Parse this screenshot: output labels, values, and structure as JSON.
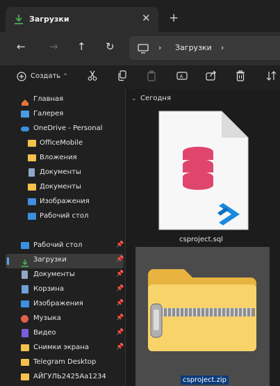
{
  "window": {
    "tab_title": "Загрузки",
    "tab_close": "✕",
    "new_tab": "+"
  },
  "nav": {
    "back": "←",
    "forward": "→",
    "up": "↑",
    "refresh": "↻",
    "sep1": "›",
    "sep2": "›",
    "crumb": "Загрузки"
  },
  "toolbar": {
    "create_label": "Создать",
    "create_chevron": "⌄"
  },
  "sidebar": {
    "top": [
      {
        "label": "Главная",
        "icon": "home-icon",
        "color": "#e8743b"
      },
      {
        "label": "Галерея",
        "icon": "gallery-icon",
        "color": "#4a9be0"
      }
    ],
    "onedrive": {
      "label": "OneDrive - Personal",
      "icon": "cloud-icon",
      "color": "#3b8fe0"
    },
    "onedrive_children": [
      {
        "label": "OfficeMobile",
        "icon": "folder-icon",
        "color": "#f2c14e"
      },
      {
        "label": "Вложения",
        "icon": "folder-icon",
        "color": "#f2c14e"
      },
      {
        "label": "Документы",
        "icon": "document-icon",
        "color": "#8fa8c8"
      },
      {
        "label": "Документы",
        "icon": "folder-icon",
        "color": "#f2c14e"
      },
      {
        "label": "Изображения",
        "icon": "pictures-icon",
        "color": "#3f8fe0"
      },
      {
        "label": "Рабочий стол",
        "icon": "desktop-icon",
        "color": "#3b8fe0"
      }
    ],
    "quick": [
      {
        "label": "Рабочий стол",
        "icon": "desktop-icon",
        "color": "#3b8fe0",
        "pinned": true
      },
      {
        "label": "Загрузки",
        "icon": "download-icon",
        "color": "#4caf50",
        "pinned": true,
        "active": true
      },
      {
        "label": "Документы",
        "icon": "document-icon",
        "color": "#8fa8c8",
        "pinned": true
      },
      {
        "label": "Корзина",
        "icon": "recycle-bin-icon",
        "color": "#6fa0d8",
        "pinned": true
      },
      {
        "label": "Изображения",
        "icon": "pictures-icon",
        "color": "#3f8fe0",
        "pinned": true
      },
      {
        "label": "Музыка",
        "icon": "music-icon",
        "color": "#e0604a",
        "pinned": true
      },
      {
        "label": "Видео",
        "icon": "video-icon",
        "color": "#7a5ce0",
        "pinned": true
      },
      {
        "label": "Снимки экрана",
        "icon": "folder-icon",
        "color": "#f2c14e",
        "pinned": true
      },
      {
        "label": "Telegram Desktop",
        "icon": "folder-icon",
        "color": "#f2c14e",
        "pinned": false
      },
      {
        "label": "АЙГУЛЬ2425Аа1234",
        "icon": "folder-icon",
        "color": "#f2c14e",
        "pinned": false
      }
    ],
    "pin_glyph": "📌"
  },
  "content": {
    "group_title": "Сегодня",
    "group_chevron": "⌄",
    "files": [
      {
        "name": "csproject.sql",
        "icon": "sql-file-icon"
      },
      {
        "name": "csproject.zip",
        "icon": "zip-folder-icon"
      }
    ]
  },
  "colors": {
    "accent": "#62a4e8",
    "selection": "#0b3a7a",
    "db_pink": "#e0456e",
    "vscode_blue": "#1a8ae0"
  }
}
